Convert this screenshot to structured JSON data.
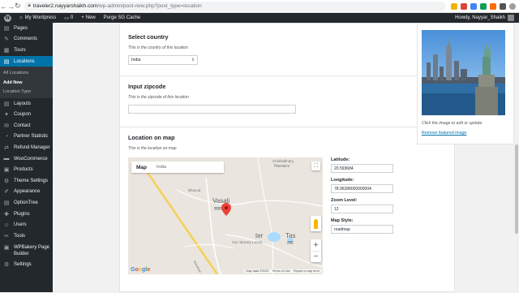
{
  "browser": {
    "url_host": "traveler2.nayyarshaikh.com",
    "url_path": "/wp-admin/post-new.php?post_type=location"
  },
  "adminbar": {
    "site_name": "My Wordpress",
    "comments_count": "0",
    "new_label": "New",
    "cache_label": "Purge SG Cache",
    "howdy": "Howdy, Nayyar_Shaikh"
  },
  "sidebar": {
    "items_top": [
      {
        "label": "Pages",
        "icon": "pages-icon",
        "glyph": "▤"
      },
      {
        "label": "Comments",
        "icon": "comments-icon",
        "glyph": "✎"
      },
      {
        "label": "Tours",
        "icon": "tours-icon",
        "glyph": "▦"
      }
    ],
    "active": {
      "label": "Locations",
      "icon": "locations-icon",
      "glyph": "▤"
    },
    "submenu": [
      {
        "label": "All Locations"
      },
      {
        "label": "Add New"
      },
      {
        "label": "Location Type"
      }
    ],
    "items_bottom": [
      {
        "label": "Layouts",
        "icon": "layouts-icon",
        "glyph": "▤"
      },
      {
        "label": "Coupon",
        "icon": "coupon-icon",
        "glyph": "✦"
      },
      {
        "label": "Contact",
        "icon": "contact-icon",
        "glyph": "✉"
      },
      {
        "label": "Partner Statistic",
        "icon": "partner-statistic-icon",
        "glyph": "◔"
      },
      {
        "label": "Refund Manager",
        "icon": "refund-manager-icon",
        "glyph": "⇄"
      },
      {
        "label": "WooCommerce",
        "icon": "woocommerce-icon",
        "glyph": "▬"
      },
      {
        "label": "Products",
        "icon": "products-icon",
        "glyph": "▣"
      },
      {
        "label": "Theme Settings",
        "icon": "theme-settings-icon",
        "glyph": "⚙"
      },
      {
        "label": "Appearance",
        "icon": "appearance-icon",
        "glyph": "✐"
      },
      {
        "label": "OptionTree",
        "icon": "optiontree-icon",
        "glyph": "▤"
      },
      {
        "label": "Plugins",
        "icon": "plugins-icon",
        "glyph": "✚"
      },
      {
        "label": "Users",
        "icon": "users-icon",
        "glyph": "☺"
      },
      {
        "label": "Tools",
        "icon": "tools-icon",
        "glyph": "✂"
      }
    ],
    "wpbakery_line1": "WPBakery Page",
    "wpbakery_line2": "Builder",
    "settings": "Settings"
  },
  "country": {
    "heading": "Select country",
    "desc": "This is the country of this location",
    "value": "India"
  },
  "zipcode": {
    "heading": "Input zipcode",
    "desc": "This is the zipcode of this location",
    "value": ""
  },
  "map_section": {
    "heading": "Location on map",
    "desc": "This is the location on map",
    "tab_map": "Map",
    "tab_region": "India",
    "place_vasali": "Vasali",
    "place_vasali_local": "वसली",
    "place_chikhalkhanj": "Chikhalkhanj",
    "place_chikhalkhanj_local": "चिखलखांज",
    "place_pond": "Bhavod",
    "place_money": "Our Money Lendi...",
    "place_tas": "Tas",
    "place_tas_local": "तस",
    "road_label": "Mandwal - Dhamora",
    "google": "Google",
    "map_data": "Map data ©2020",
    "terms": "Terms of Use",
    "report": "Report a map error",
    "latitude_label": "Latitude:",
    "latitude_value": "20.593684",
    "longitude_label": "Longitude:",
    "longitude_value": "78.96288000000004",
    "zoom_label": "Zoom Level:",
    "zoom_value": "12",
    "style_label": "Map Style:",
    "style_value": "roadmap"
  },
  "featured_image": {
    "caption": "Click the image to edit or update",
    "remove_link": "Remove featured image"
  },
  "colors": {
    "wp_blue": "#0073aa",
    "sidebar_dark": "#23282d",
    "map_pin_red": "#ea4335"
  }
}
